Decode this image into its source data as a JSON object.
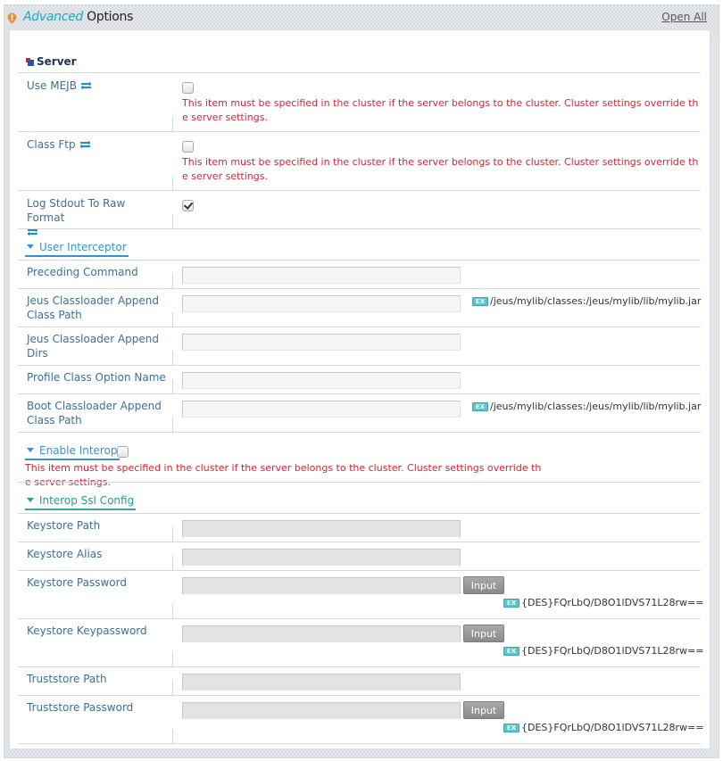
{
  "header": {
    "title_accent": "Advanced",
    "title_rest": "Options",
    "open_all": "Open All"
  },
  "colors": {
    "accent_teal": "#1aa9c4",
    "label_blue": "#3f6f94",
    "warning_red": "#e02030",
    "group_blue": "#3b8fd0",
    "group_teal": "#2a9a8f"
  },
  "section": {
    "title": "Server"
  },
  "warning_text": "This item must be specified in the cluster if the server belongs to the cluster. Cluster settings override the server settings.",
  "server_fields": [
    {
      "label": "Use MEJB",
      "checked": false,
      "dynamic": true
    },
    {
      "label": "Class Ftp",
      "checked": false,
      "dynamic": true
    },
    {
      "label": "Log Stdout To Raw Format",
      "checked": true,
      "dynamic": true
    }
  ],
  "user_interceptor": {
    "title": "User Interceptor",
    "fields": [
      {
        "label": "Preceding Command",
        "value": "",
        "example": ""
      },
      {
        "label": "Jeus Classloader Append Class Path",
        "value": "",
        "example": "/jeus/mylib/classes:/jeus/mylib/lib/mylib.jar"
      },
      {
        "label": "Jeus Classloader Append Dirs",
        "value": "",
        "example": ""
      },
      {
        "label": "Profile Class Option Name",
        "value": "",
        "example": ""
      },
      {
        "label": "Boot Classloader Append Class Path",
        "value": "",
        "example": "/jeus/mylib/classes:/jeus/mylib/lib/mylib.jar"
      }
    ]
  },
  "enable_interop": {
    "title": "Enable Interop",
    "checked": false
  },
  "interop_ssl": {
    "title": "Interop Ssl Config",
    "fields": [
      {
        "label": "Keystore Path",
        "value": ""
      },
      {
        "label": "Keystore Alias",
        "value": ""
      },
      {
        "label": "Keystore Password",
        "value": "",
        "button": "Input",
        "example": "{DES}FQrLbQ/D8O1lDVS71L28rw=="
      },
      {
        "label": "Keystore Keypassword",
        "value": "",
        "button": "Input",
        "example": "{DES}FQrLbQ/D8O1lDVS71L28rw=="
      },
      {
        "label": "Truststore Path",
        "value": ""
      },
      {
        "label": "Truststore Password",
        "value": "",
        "button": "Input",
        "example": "{DES}FQrLbQ/D8O1lDVS71L28rw=="
      }
    ]
  },
  "icons": {
    "header": "alert-pin-icon",
    "section": "server-icon",
    "dynamic": "refresh-icon",
    "example": "ex-badge-icon",
    "group": "triangle-down-icon"
  }
}
